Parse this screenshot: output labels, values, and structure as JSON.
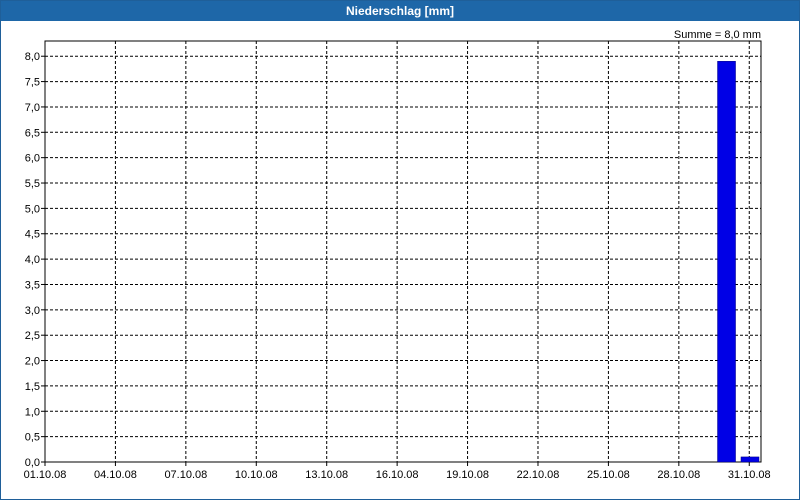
{
  "window": {
    "title": "Niederschlag [mm]"
  },
  "chart_data": {
    "type": "bar",
    "title": "Niederschlag [mm]",
    "annotation": "Summe = 8,0 mm",
    "xlabel": "",
    "ylabel": "",
    "ylim": [
      0,
      8.3
    ],
    "grid": true,
    "x_tick_labels": [
      "01.10.08",
      "04.10.08",
      "07.10.08",
      "10.10.08",
      "13.10.08",
      "16.10.08",
      "19.10.08",
      "22.10.08",
      "25.10.08",
      "28.10.08",
      "31.10.08"
    ],
    "y_tick_labels": [
      "0,0",
      "0,5",
      "1,0",
      "1,5",
      "2,0",
      "2,5",
      "3,0",
      "3,5",
      "4,0",
      "4,5",
      "5,0",
      "5,5",
      "6,0",
      "6,5",
      "7,0",
      "7,5",
      "8,0"
    ],
    "y_tick_values": [
      0,
      0.5,
      1.0,
      1.5,
      2.0,
      2.5,
      3.0,
      3.5,
      4.0,
      4.5,
      5.0,
      5.5,
      6.0,
      6.5,
      7.0,
      7.5,
      8.0
    ],
    "x": [
      "2008-10-30",
      "2008-10-31"
    ],
    "values": [
      7.9,
      0.1
    ],
    "bar_color": "#0000e6"
  }
}
